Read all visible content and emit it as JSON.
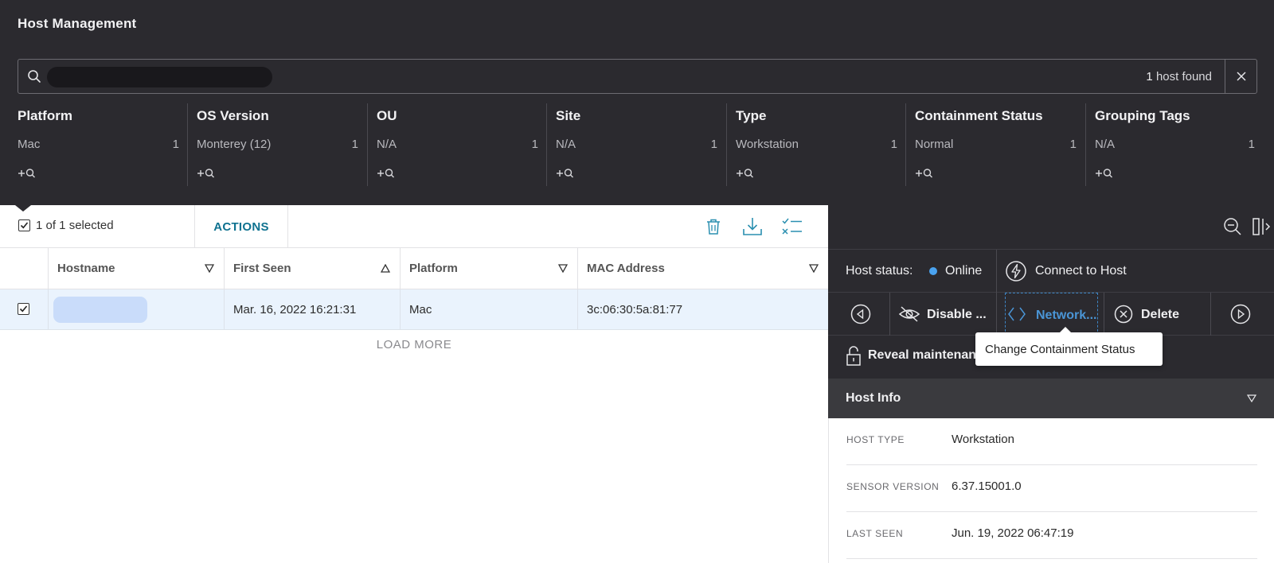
{
  "header": {
    "title": "Host Management",
    "search": {
      "count": "1",
      "count_label": "host found"
    },
    "facets": [
      {
        "title": "Platform",
        "value": "Mac",
        "count": "1"
      },
      {
        "title": "OS Version",
        "value": "Monterey (12)",
        "count": "1"
      },
      {
        "title": "OU",
        "value": "N/A",
        "count": "1"
      },
      {
        "title": "Site",
        "value": "N/A",
        "count": "1"
      },
      {
        "title": "Type",
        "value": "Workstation",
        "count": "1"
      },
      {
        "title": "Containment Status",
        "value": "Normal",
        "count": "1"
      },
      {
        "title": "Grouping Tags",
        "value": "N/A",
        "count": "1"
      }
    ]
  },
  "table": {
    "selected_text": "1 of 1 selected",
    "actions_label": "ACTIONS",
    "columns": [
      {
        "label": "Hostname",
        "sort": "filter"
      },
      {
        "label": "First Seen",
        "sort": "asc"
      },
      {
        "label": "Platform",
        "sort": "filter"
      },
      {
        "label": "MAC Address",
        "sort": "filter"
      }
    ],
    "rows": [
      {
        "hostname": "",
        "first_seen": "Mar. 16, 2022 16:21:31",
        "platform": "Mac",
        "mac": "3c:06:30:5a:81:77"
      }
    ],
    "load_more": "LOAD MORE"
  },
  "panel": {
    "status_label": "Host status:",
    "status_value": "Online",
    "status_color": "#4aa3f0",
    "connect_label": "Connect to Host",
    "actions": [
      {
        "label": "Disable ...",
        "icon": "eye-slash-icon"
      },
      {
        "label": "Network...",
        "icon": "network-contain-icon"
      },
      {
        "label": "Delete",
        "icon": "x-circle-icon"
      }
    ],
    "reveal_label": "Reveal maintenance token",
    "tooltip": "Change Containment Status",
    "info_title": "Host Info",
    "info": [
      {
        "key": "HOST TYPE",
        "value": "Workstation"
      },
      {
        "key": "SENSOR VERSION",
        "value": "6.37.15001.0"
      },
      {
        "key": "LAST SEEN",
        "value": "Jun. 19, 2022 06:47:19"
      }
    ]
  },
  "colors": {
    "header_bg": "#2b2a2f",
    "accent": "#0f7290",
    "row_selected": "#eaf3fd",
    "network_active": "#4a95d6"
  }
}
